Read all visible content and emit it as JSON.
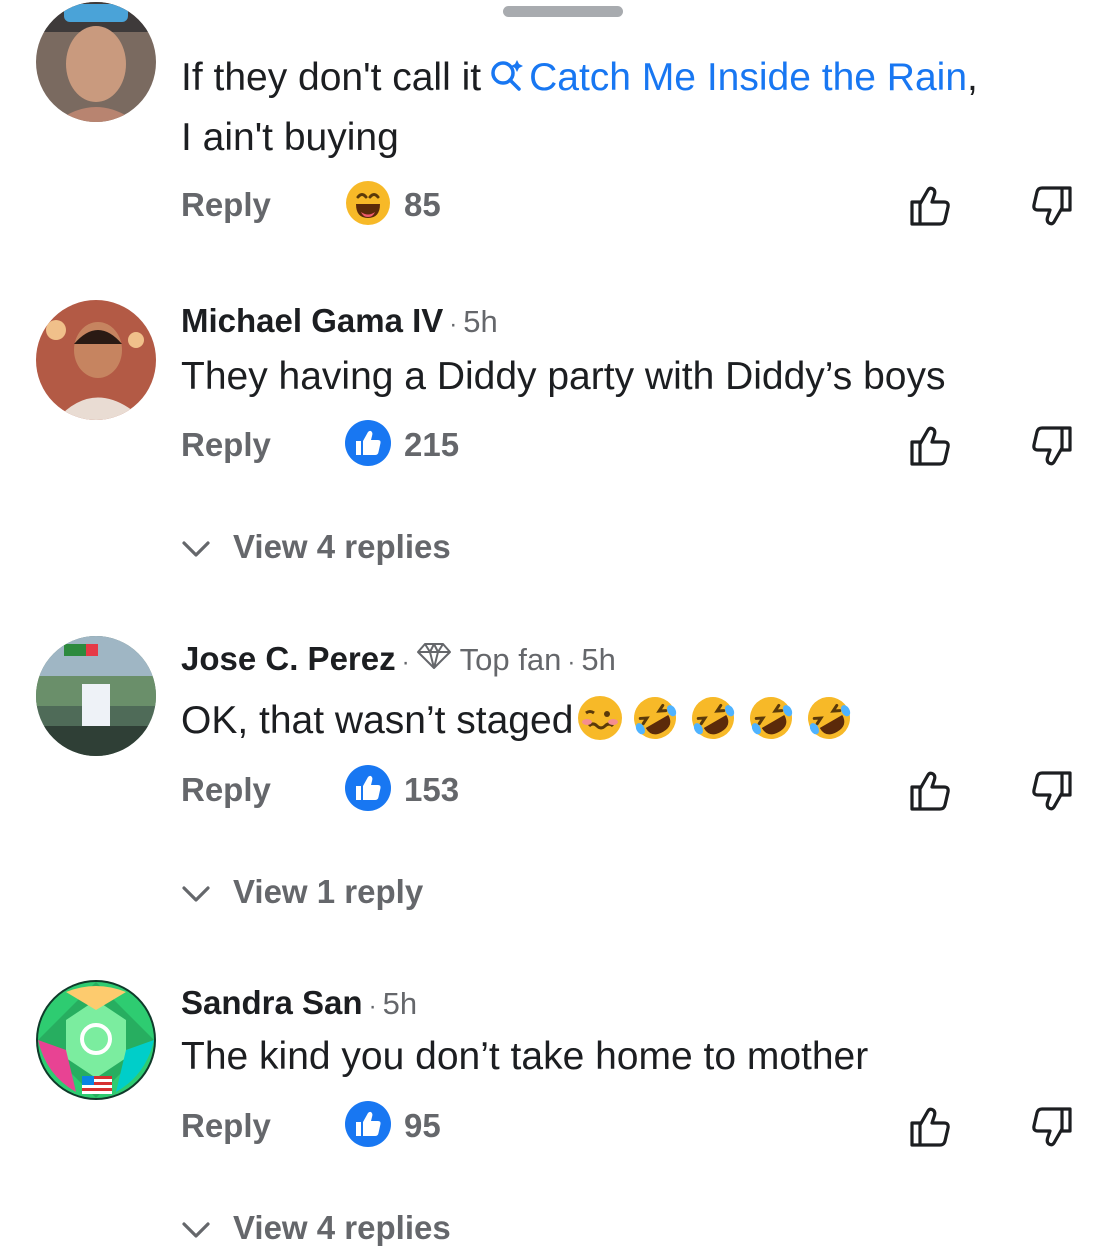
{
  "comments": [
    {
      "line1_prefix": "If they don't call it",
      "tag_text": "Catch Me Inside the Rain",
      "line1_suffix": ",",
      "line2": "I ain't buying",
      "reply_label": "Reply",
      "reaction_type": "haha",
      "reaction_count": "85"
    },
    {
      "author": "Michael Gama IV",
      "time": "5h",
      "text": "They having a Diddy party with Diddy’s boys",
      "reply_label": "Reply",
      "reaction_type": "like",
      "reaction_count": "215",
      "view_replies": "View 4 replies"
    },
    {
      "author": "Jose C. Perez",
      "badge": "Top fan",
      "time": "5h",
      "text": "OK, that wasn’t staged",
      "reply_label": "Reply",
      "reaction_type": "like",
      "reaction_count": "153",
      "view_replies": "View 1 reply"
    },
    {
      "author": "Sandra San",
      "time": "5h",
      "text": "The kind you don’t take home to mother",
      "reply_label": "Reply",
      "reaction_type": "like",
      "reaction_count": "95",
      "view_replies": "View 4 replies"
    }
  ],
  "colors": {
    "link": "#1877f2",
    "secondary_text": "#65676b",
    "like_blue": "#1877f2",
    "haha_yellow": "#f7b928"
  },
  "icons": [
    "visual-search-icon",
    "haha-reaction-icon",
    "like-reaction-icon",
    "thumbs-up-icon",
    "thumbs-down-icon",
    "chevron-down-icon",
    "diamond-icon"
  ]
}
